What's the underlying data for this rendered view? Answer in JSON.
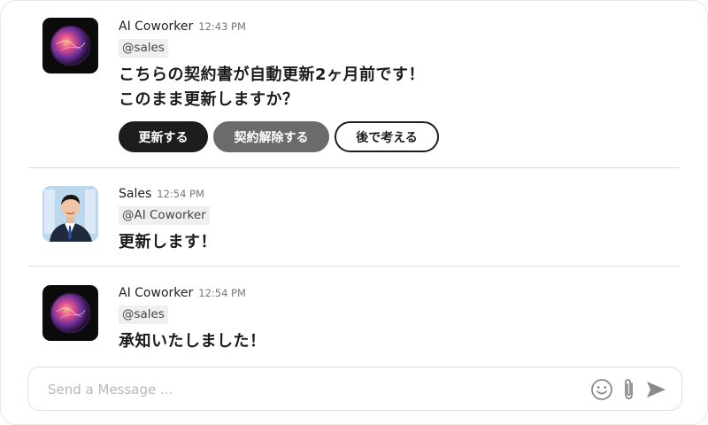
{
  "messages": [
    {
      "sender": "AI Coworker",
      "time": "12:43 PM",
      "mention": "@sales",
      "text_line1": "こちらの契約書が自動更新2ヶ月前です！",
      "text_line2": "このまま更新しますか？",
      "actions": [
        "更新する",
        "契約解除する",
        "後で考える"
      ]
    },
    {
      "sender": "Sales",
      "time": "12:54 PM",
      "mention": "@AI Coworker",
      "text_line1": "更新します！"
    },
    {
      "sender": "AI Coworker",
      "time": "12:54 PM",
      "mention": "@sales",
      "text_line1": "承知いたしました！"
    }
  ],
  "composer": {
    "placeholder": "Send a Message ...",
    "icons": [
      "emoji-icon",
      "paperclip-icon",
      "send-icon"
    ]
  },
  "colors": {
    "primary_button": "#1d1d1d",
    "secondary_button": "#6b6b6b",
    "divider": "#dcdcdc"
  }
}
